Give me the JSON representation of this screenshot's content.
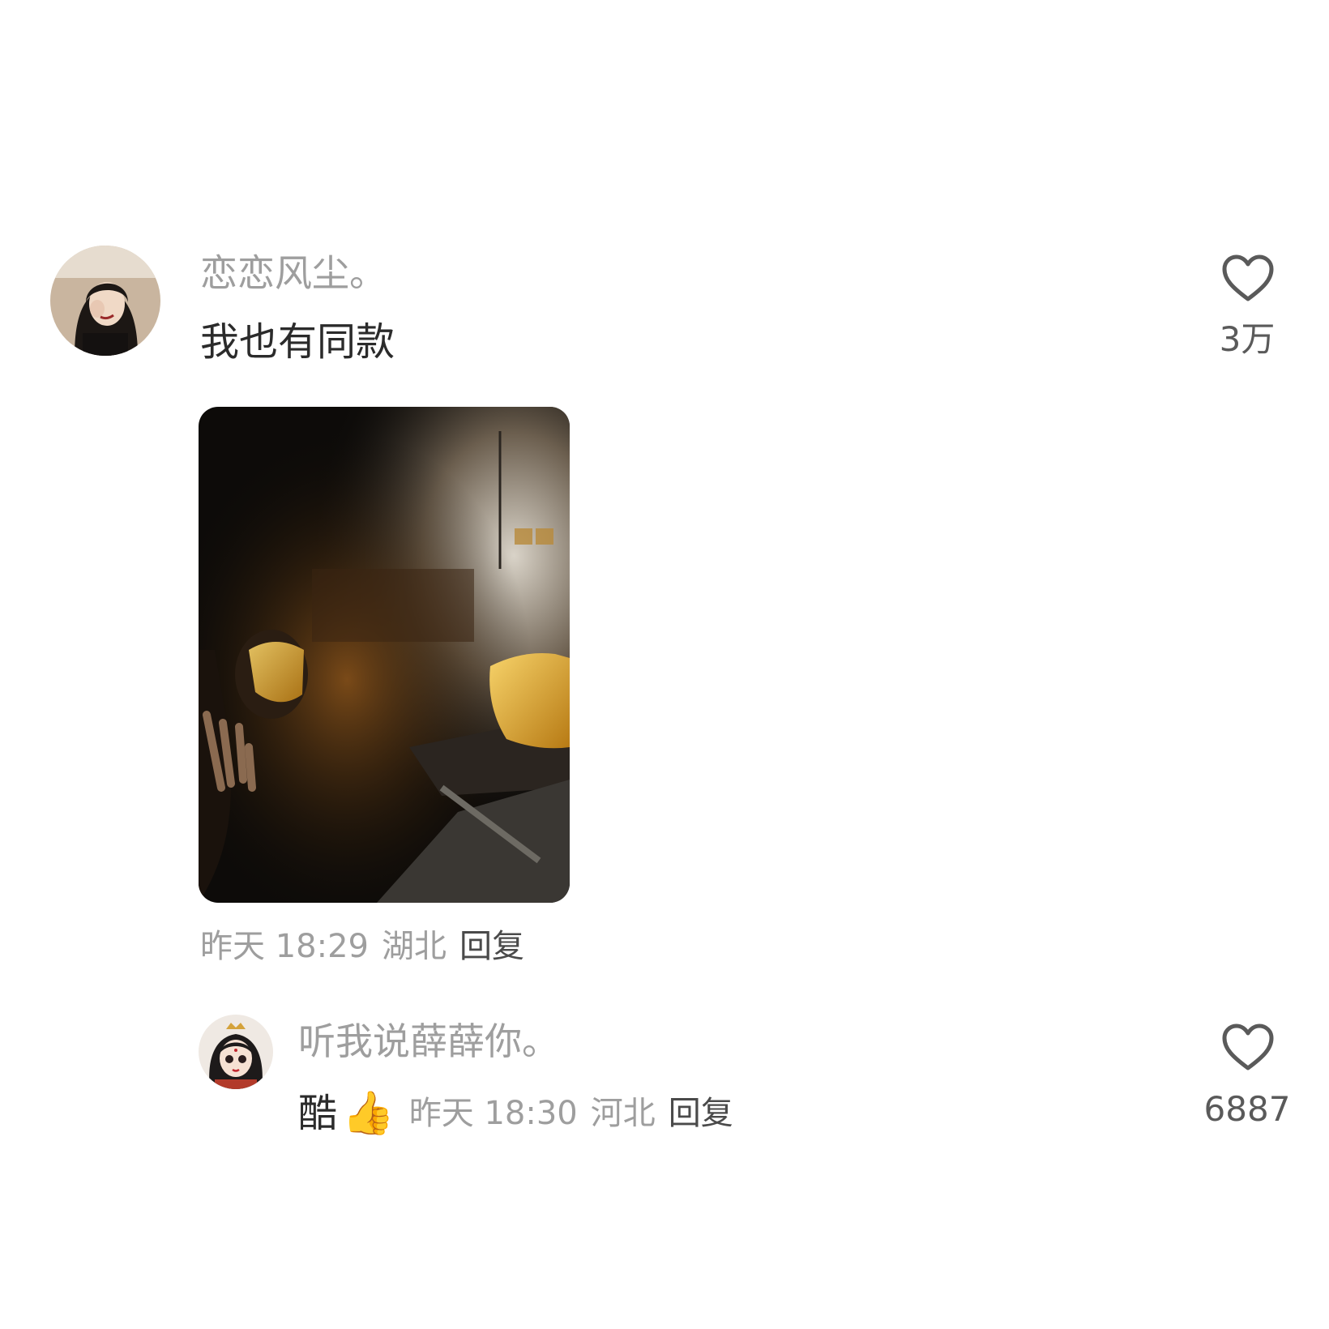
{
  "comment": {
    "username": "恋恋风尘。",
    "text": "我也有同款",
    "time": "昨天 18:29",
    "location": "湖北",
    "reply_label": "回复",
    "like_count": "3万",
    "avatar_icon": "user-avatar-photo",
    "image_icon": "museum-golden-mask-photo"
  },
  "reply": {
    "username": "听我说薛薛你。",
    "text": "酷",
    "emoji": "👍",
    "time": "昨天 18:30",
    "location": "河北",
    "reply_label": "回复",
    "like_count": "6887",
    "avatar_icon": "cartoon-girl-avatar"
  },
  "colors": {
    "username": "#9e9e9e",
    "text": "#2b2b2b",
    "meta": "#9e9e9e",
    "reply": "#4a4a4a",
    "icon": "#5a5a5a"
  }
}
